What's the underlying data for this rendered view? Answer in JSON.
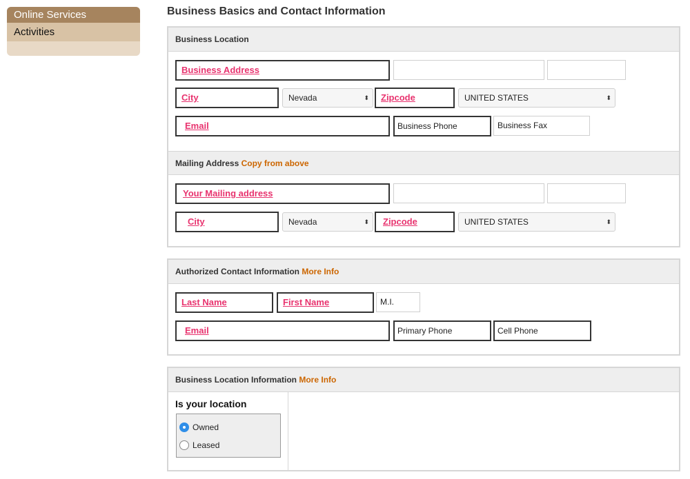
{
  "sidebar": {
    "header": "Online Services",
    "items": [
      {
        "label": "Activities"
      }
    ]
  },
  "page_title": "Business Basics and Contact Information",
  "business_location": {
    "heading": "Business Location",
    "address_label": "Business Address",
    "city_label": "City",
    "state_value": "Nevada",
    "zip_label": "Zipcode",
    "country_value": "UNITED STATES",
    "email_label": "Email",
    "phone_placeholder": "Business Phone",
    "fax_placeholder": "Business Fax"
  },
  "mailing_address": {
    "heading": "Mailing Address",
    "copy_link": "Copy from above",
    "address_label": "Your Mailing address",
    "city_label": "City",
    "state_value": "Nevada",
    "zip_label": "Zipcode",
    "country_value": "UNITED STATES"
  },
  "authorized_contact": {
    "heading": "Authorized Contact Information",
    "more_info": "More Info",
    "last_name_label": "Last Name",
    "first_name_label": "First Name",
    "mi_placeholder": "M.I.",
    "email_label": "Email",
    "primary_phone": "Primary Phone",
    "cell_phone": "Cell Phone"
  },
  "location_info": {
    "heading": "Business Location Information",
    "more_info": "More Info",
    "question": "Is your location",
    "options": [
      {
        "label": "Owned",
        "selected": true
      },
      {
        "label": "Leased",
        "selected": false
      }
    ]
  },
  "colors": {
    "required_label": "#e8326e",
    "link": "#cc6600",
    "sidebar_header": "#a6845e",
    "sidebar_item": "#d8c2a5"
  },
  "icons": {
    "select_arrow": "up-down-arrows-icon"
  }
}
